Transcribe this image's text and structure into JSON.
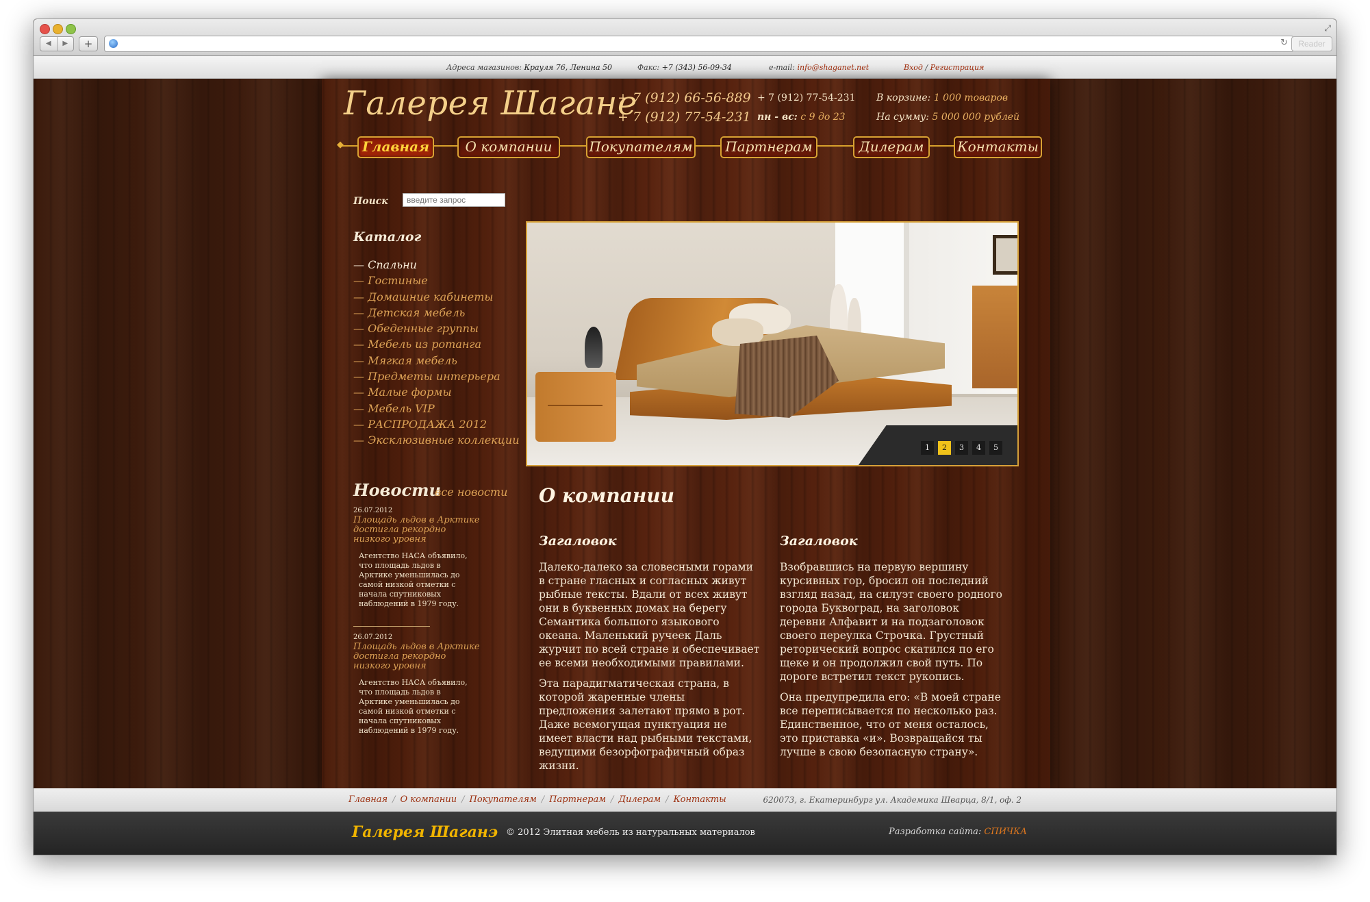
{
  "browser": {
    "reader_label": "Reader",
    "back_icon": "◀",
    "forward_icon": "▶",
    "add_icon": "+",
    "reload_icon": "↻"
  },
  "topbar": {
    "address_label": "Адреса магазинов:",
    "address_value": "Крауля 76, Ленина 50",
    "fax_label": "Факс:",
    "fax_value": "+7 (343) 56-09-34",
    "email_label": "e-mail:",
    "email_value": "info@shaganet.net",
    "login": "Вход",
    "separator": "/",
    "register": "Регистрация"
  },
  "header": {
    "logo": "Галерея Шагане",
    "phones": [
      "+ 7 (912) 66-56-889",
      "+ 7 (912) 77-54-231"
    ],
    "phone_small": "+ 7 (912) 77-54-231",
    "hours_label": "пн - вс:",
    "hours_value": "с 9 до 23",
    "cart_label": "В корзине:",
    "cart_value": "1 000 товаров",
    "sum_label": "На сумму:",
    "sum_value": "5 000 000 рублей"
  },
  "nav": {
    "items": [
      "Главная",
      "О компании",
      "Покупателям",
      "Партнерам",
      "Дилерам",
      "Контакты"
    ],
    "active_index": 0
  },
  "search": {
    "label": "Поиск",
    "placeholder": "введите запрос"
  },
  "catalog": {
    "title": "Каталог",
    "items": [
      "— Спальни",
      "— Гостиные",
      "— Домашние кабинеты",
      "— Детская мебель",
      "— Обеденные группы",
      "— Мебель из ротанга",
      "— Мягкая мебель",
      "— Предметы интерьера",
      "— Малые формы",
      "— Мебель VIP",
      "— РАСПРОДАЖА 2012",
      "— Эксклюзивные коллекции"
    ]
  },
  "news": {
    "title": "Новости",
    "all_link": "все новости",
    "items": [
      {
        "date": "26.07.2012",
        "headline": "Площадь льдов в Арктике достигла рекордно низкого уровня",
        "body": "Агентство НАСА объявило, что площадь льдов в Арктике уменьшилась до самой низкой отметки с начала спутниковых наблюдений в 1979 году."
      },
      {
        "date": "26.07.2012",
        "headline": "Площадь льдов в Арктике достигла рекордно низкого уровня",
        "body": "Агентство НАСА объявило, что площадь льдов в Арктике уменьшилась до самой низкой отметки с начала спутниковых наблюдений в 1979 году."
      }
    ]
  },
  "slider": {
    "pages": [
      "1",
      "2",
      "3",
      "4",
      "5"
    ],
    "active_page": "2"
  },
  "about": {
    "title": "О компании",
    "columns": [
      {
        "heading": "Загаловок",
        "paragraphs": [
          "Далеко-далеко за словесными горами в стране гласных и согласных живут рыбные тексты. Вдали от всех живут они в буквенных домах на берегу Семантика большого языкового океана. Маленький ручеек Даль журчит по всей стране и обеспечивает ее всеми необходимыми правилами.",
          "Эта парадигматическая страна, в которой жаренные члены предложения залетают прямо в рот. Даже всемогущая пунктуация не имеет власти над рыбными текстами, ведущими безорфографичный образ жизни."
        ]
      },
      {
        "heading": "Загаловок",
        "paragraphs": [
          "Взобравшись на первую вершину курсивных гор, бросил он последний взгляд назад, на силуэт своего родного города Буквоград, на заголовок деревни Алфавит и на подзаголовок своего переулка Строчка. Грустный реторический вопрос скатился по его щеке и он продолжил свой путь. По дороге встретил текст рукопись.",
          "Она предупредила его: «В моей стране все переписывается по несколько раз. Единственное, что от меня осталось, это приставка «и». Возвращайся ты лучше в свою безопасную страну»."
        ]
      }
    ]
  },
  "footer_nav": {
    "links": [
      "Главная",
      "О компании",
      "Покупателям",
      "Партнерам",
      "Дилерам",
      "Контакты"
    ],
    "separator": "/",
    "address": "620073, г. Екатеринбург ул. Академика Шварца, 8/1, оф. 2"
  },
  "footer": {
    "logo": "Галерея Шаганэ",
    "copyright": "© 2012 Элитная мебель из натуральных материалов",
    "dev_label": "Разработка сайта:",
    "dev_link": "СПИЧКА"
  },
  "colors": {
    "accent_gold": "#d9a233",
    "link_orange": "#dca256",
    "nav_active_text": "#ffd23a",
    "footer_bg": "#2b2b2b"
  }
}
